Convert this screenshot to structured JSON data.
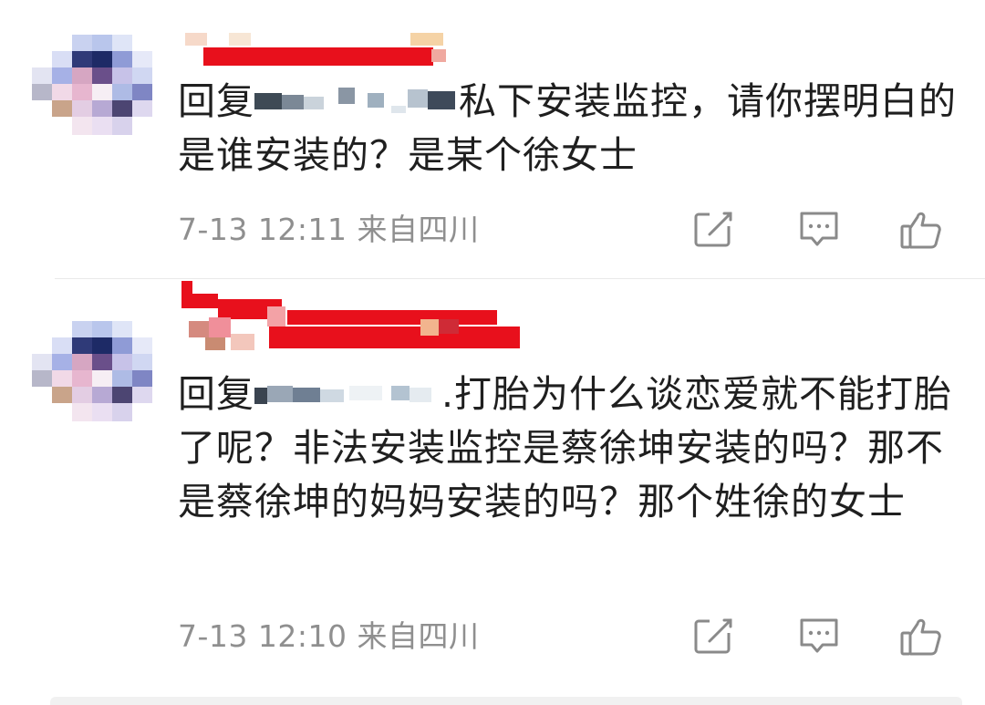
{
  "comments": [
    {
      "reply_prefix": "回复",
      "text_after_mask": "私下安装监控，请你摆明白的是谁安装的？是某个徐女士",
      "timestamp": "7-13 12:11",
      "location": "来自四川",
      "actions": [
        "edit-icon",
        "comment-icon",
        "thumbs-up-icon"
      ]
    },
    {
      "reply_prefix": "回复",
      "text_after_mask": ".打胎为什么谈恋爱就不能打胎了呢？非法安装监控是蔡徐坤安装的吗？那不是蔡徐坤的妈妈安装的吗？那个姓徐的女士",
      "timestamp": "7-13 12:10",
      "location": "来自四川",
      "actions": [
        "edit-icon",
        "comment-icon",
        "thumbs-up-icon"
      ]
    }
  ],
  "colors": {
    "text": "#1f1f1f",
    "meta": "#8f8f8f",
    "icon": "#8a8a8a",
    "username_mask_red": "#e8101c",
    "divider": "#e9e9e9"
  }
}
